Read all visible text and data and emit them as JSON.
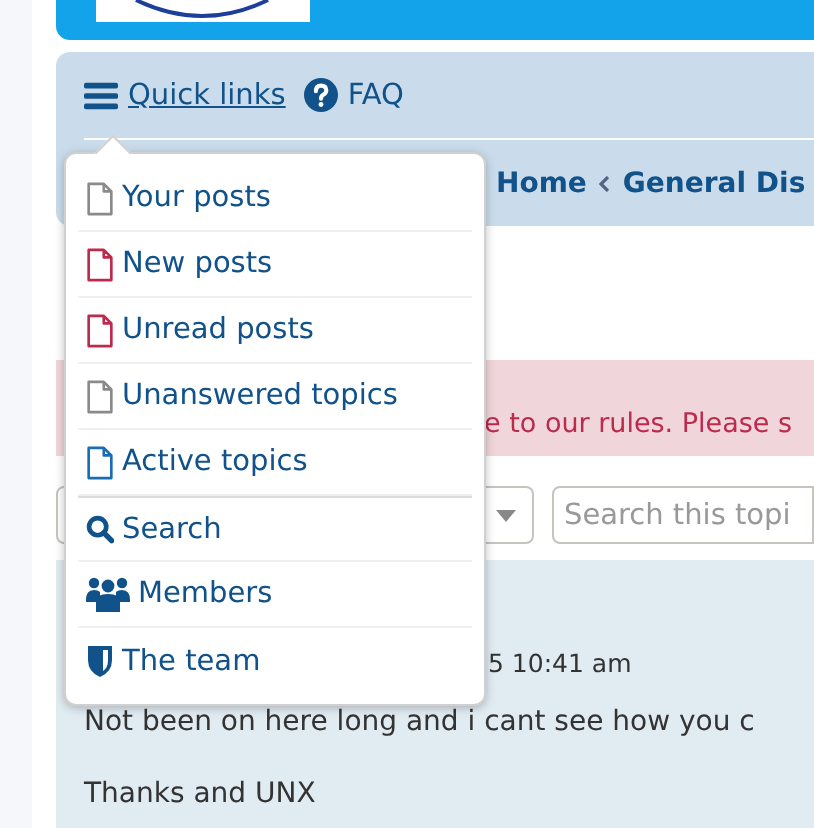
{
  "navbar": {
    "quick_links": "Quick links",
    "faq": "FAQ"
  },
  "breadcrumbs": [
    {
      "label": "Home"
    },
    {
      "label": "General Dis"
    }
  ],
  "notice": "e to our rules. Please s",
  "search": {
    "placeholder": "Search this topi"
  },
  "post": {
    "date": "5 10:41 am",
    "lines": [
      "Not been on here long and i cant see how you c",
      "Thanks and UNX"
    ]
  },
  "quick_links_menu": {
    "open": true,
    "items": [
      {
        "label": "Your posts",
        "kind": "file",
        "color": "#8a8a8a"
      },
      {
        "label": "New posts",
        "kind": "file",
        "color": "#bc2a4d"
      },
      {
        "label": "Unread posts",
        "kind": "file",
        "color": "#bc2a4d"
      },
      {
        "label": "Unanswered topics",
        "kind": "file",
        "color": "#8a8a8a"
      },
      {
        "label": "Active topics",
        "kind": "file",
        "color": "#196db5"
      },
      {
        "label": "Search",
        "kind": "search"
      },
      {
        "label": "Members",
        "kind": "members"
      },
      {
        "label": "The team",
        "kind": "team"
      }
    ]
  }
}
